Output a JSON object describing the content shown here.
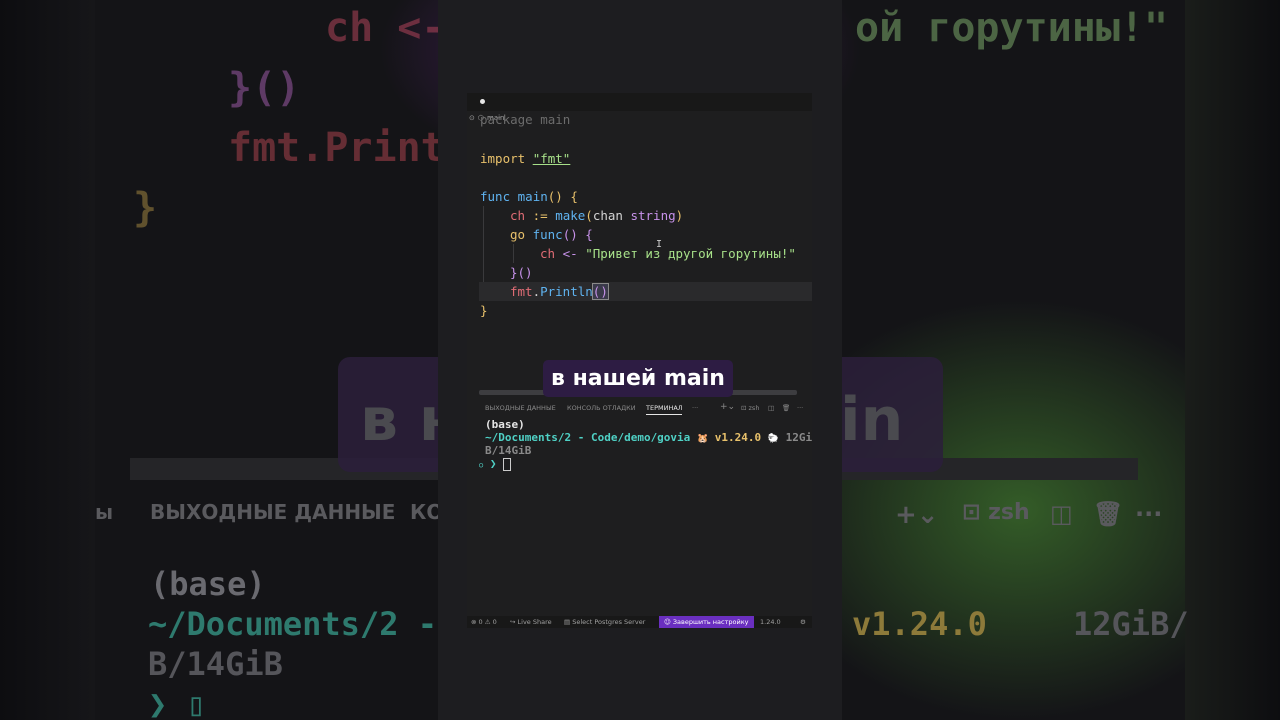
{
  "editor": {
    "breadcrumb": "main",
    "lines": {
      "l0": "package main",
      "l1_kw": "import",
      "l1_str": "\"fmt\"",
      "l2_kw": "func",
      "l2_fn": "main",
      "l2_rest": "() {",
      "l3_var": "ch",
      "l3_op": ":=",
      "l3_fn": "make",
      "l3_open": "(",
      "l3_chan": "chan",
      "l3_typ": "string",
      "l3_close": ")",
      "l4_kw": "go",
      "l4_fn": "func",
      "l4_rest": "() {",
      "l5_var": "ch",
      "l5_op": "<-",
      "l5_str": "\"Привет из другой горутины!\"",
      "l6": "}()",
      "l7_pkg": "fmt",
      "l7_dot": ".",
      "l7_fn": "Println",
      "l7_parens": "()",
      "l8": "}"
    }
  },
  "panel": {
    "tabs": {
      "output": "ВЫХОДНЫЕ ДАННЫЕ",
      "debug": "КОНСОЛЬ ОТЛАДКИ",
      "terminal": "ТЕРМИНАЛ",
      "more": "···"
    },
    "shell": "zsh"
  },
  "terminal": {
    "env": "(base)",
    "path": "~/Documents/2 - Code/demo/govia",
    "version": "v1.24.0",
    "mem1": "12GiB/",
    "mem2": "B/14GiB",
    "prompt": "❯"
  },
  "statusbar": {
    "problems": "⊗ 0 ⚠ 0",
    "liveshare": "Live Share",
    "postgres": "Select Postgres Server",
    "setup": "Завершить настройку",
    "version": "1.24.0"
  },
  "caption": "в нашей main",
  "background": {
    "code1": "ch <-",
    "code1b": "ой горутины!\"",
    "code2": "}()",
    "code3": "fmt.Printl",
    "code4": "}",
    "pill_left": "в н",
    "pill_right": "in",
    "tab1": "ы",
    "tab2": "ВЫХОДНЫЕ ДАННЫЕ",
    "tab3": "КО",
    "shell": "zsh",
    "term_env": "(base)",
    "term_path": "~/Documents/2 -",
    "term_version": "v1.24.0",
    "term_mem": "12GiB/",
    "term_mem2": "B/14GiB"
  },
  "colors": {
    "accent": "#6a2fc0",
    "caption_bg": "#2d1c43",
    "terminal_path": "#4fd1c5",
    "terminal_version": "#e8c16b"
  }
}
